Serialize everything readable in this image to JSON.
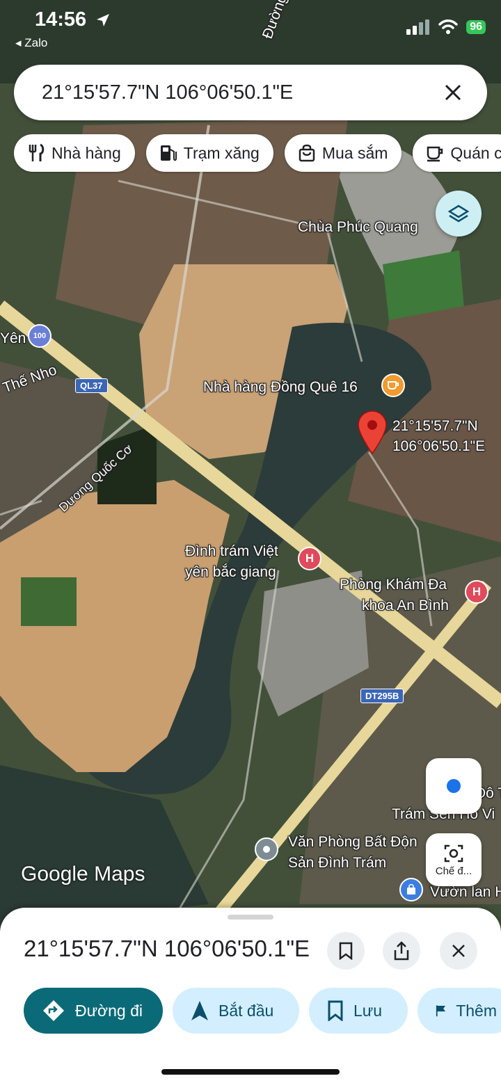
{
  "status_bar": {
    "time": "14:56",
    "back_label": "◂ Zalo",
    "battery": "96"
  },
  "search": {
    "query": "21°15'57.7\"N 106°06'50.1\"E"
  },
  "chips": [
    {
      "icon": "restaurant-icon",
      "label": "Nhà hàng"
    },
    {
      "icon": "gas-station-icon",
      "label": "Trạm xăng"
    },
    {
      "icon": "shopping-bag-icon",
      "label": "Mua sắm"
    },
    {
      "icon": "coffee-icon",
      "label": "Quán c"
    }
  ],
  "map": {
    "pin_line1": "21°15'57.7\"N",
    "pin_line2": "106°06'50.1\"E",
    "places": {
      "chua": "Chùa Phúc Quang",
      "yen": "Yên",
      "the_nho": "Thế Nho",
      "nha_hang": "Nhà hàng Đồng Quê 16",
      "duong_quoc_cd": "Dương Quốc Cơ",
      "dinh_tram_1": "Đình trám Việt",
      "dinh_tram_2": "yên bắc giang",
      "phong_kham_1": "Phòng Khám Đa",
      "phong_kham_2": "khoa An Bình",
      "tram_sen": "Trám Sen Hồ Vi",
      "do_t": "Đô T",
      "van_phong_1": "Văn Phòng Bất Độn",
      "van_phong_2": "Sản Đình Trám",
      "vuon_lan": "Vườn lan H",
      "duong_top": "Đường"
    },
    "road_badges": {
      "ql37": "QL37",
      "dt295b": "DT295B",
      "poi_100": "100"
    },
    "google_logo": "Google",
    "maps_word": "Maps",
    "lens_label": "Chế đ..."
  },
  "sheet": {
    "title": "21°15'57.7\"N 106°06'50.1\"E",
    "actions": [
      {
        "icon": "directions-icon",
        "label": "Đường đi"
      },
      {
        "icon": "navigation-arrow-icon",
        "label": "Bắt đầu"
      },
      {
        "icon": "bookmark-icon",
        "label": "Lưu"
      },
      {
        "icon": "flag-icon",
        "label": "Thêm"
      }
    ]
  },
  "colors": {
    "primary_teal": "#0b6a77",
    "secondary_blue": "#d3efff",
    "road_yellow": "#e8d79a",
    "pin_red": "#ea4335"
  }
}
